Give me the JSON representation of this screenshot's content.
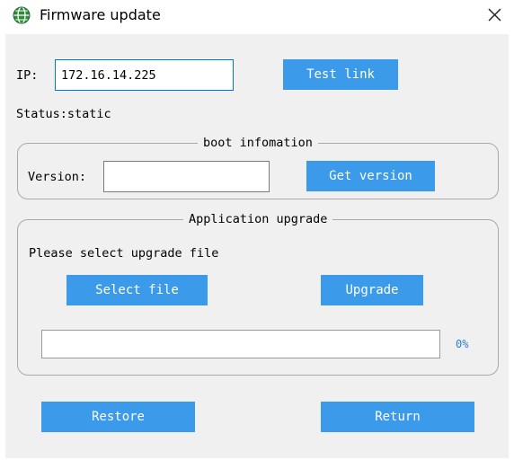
{
  "window": {
    "title": "Firmware update",
    "icon": "green-globe-icon",
    "close_icon": "close-icon"
  },
  "connection": {
    "ip_label": "IP:",
    "ip_value": "172.16.14.225",
    "test_link_label": "Test link",
    "status_text": "Status:static"
  },
  "boot_info": {
    "legend": "boot infomation",
    "version_label": "Version:",
    "version_value": "",
    "get_version_label": "Get version"
  },
  "app_upgrade": {
    "legend": "Application upgrade",
    "prompt": "Please select upgrade file",
    "select_file_label": "Select file",
    "upgrade_label": "Upgrade",
    "progress_percent": 0,
    "progress_text": "0%"
  },
  "footer": {
    "restore_label": "Restore",
    "return_label": "Return"
  },
  "colors": {
    "button_bg": "#3b9aea",
    "button_text": "#ffffff",
    "focus_border": "#0078d7",
    "percent_text": "#2a7fd4",
    "dialog_bg": "#f0f0f0",
    "icon_green": "#2e8b3a"
  }
}
